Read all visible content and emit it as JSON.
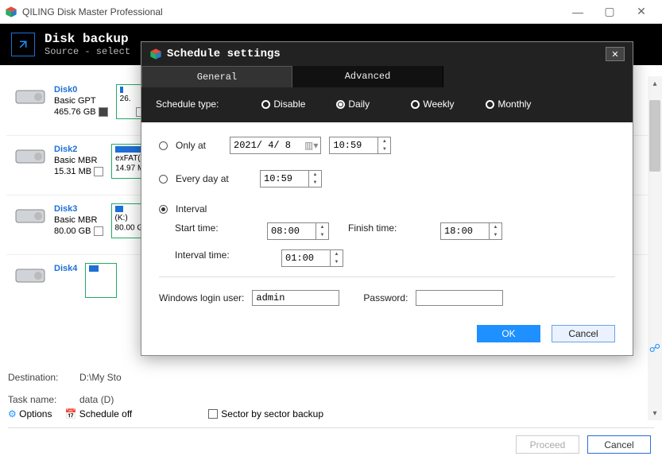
{
  "app": {
    "title": "QILING Disk Master Professional"
  },
  "windowControls": {
    "min": "—",
    "max": "▢",
    "close": "✕"
  },
  "header": {
    "title": "Disk backup",
    "subtitle": "Source - select"
  },
  "disks": [
    {
      "name": "Disk0",
      "type": "Basic GPT",
      "size": "465.76 GB",
      "checked": true,
      "partLine": "26."
    },
    {
      "name": "Disk2",
      "type": "Basic MBR",
      "size": "15.31 MB",
      "checked": false,
      "partLabel": "exFAT(E",
      "partLine": "14.97 M"
    },
    {
      "name": "Disk3",
      "type": "Basic MBR",
      "size": "80.00 GB",
      "checked": false,
      "partLabel": "(K:)",
      "partLine": "80.00 G"
    },
    {
      "name": "Disk4",
      "type": "",
      "size": "",
      "checked": false,
      "partLabel": "",
      "partLine": ""
    }
  ],
  "destination": {
    "label": "Destination:",
    "value": "D:\\My Sto"
  },
  "taskname": {
    "label": "Task name:",
    "value": "data (D)"
  },
  "options": {
    "optionsLabel": "Options",
    "scheduleOff": "Schedule off",
    "sectorLabel": "Sector by sector backup"
  },
  "footer": {
    "proceed": "Proceed",
    "cancel": "Cancel"
  },
  "dialog": {
    "title": "Schedule settings",
    "tabs": {
      "general": "General",
      "advanced": "Advanced"
    },
    "scheduleTypeLabel": "Schedule type:",
    "types": {
      "disable": "Disable",
      "daily": "Daily",
      "weekly": "Weekly",
      "monthly": "Monthly"
    },
    "selectedType": "Daily",
    "onlyAt": {
      "label": "Only at",
      "date": "2021/ 4/ 8",
      "time": "10:59"
    },
    "everyDay": {
      "label": "Every day at",
      "time": "10:59"
    },
    "interval": {
      "label": "Interval",
      "startLabel": "Start time:",
      "start": "08:00",
      "finishLabel": "Finish time:",
      "finish": "18:00",
      "intervalLabel": "Interval time:",
      "interval": "01:00"
    },
    "login": {
      "userLabel": "Windows login user:",
      "user": "admin",
      "passLabel": "Password:",
      "pass": ""
    },
    "buttons": {
      "ok": "OK",
      "cancel": "Cancel"
    }
  }
}
